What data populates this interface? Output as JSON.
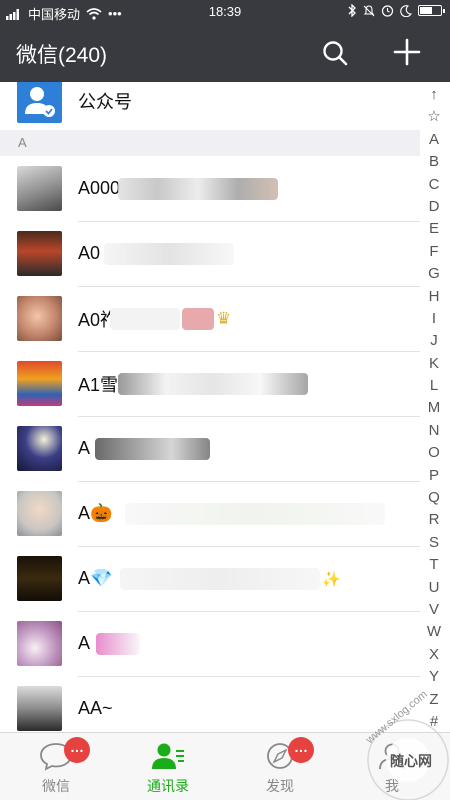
{
  "status_bar": {
    "carrier": "中国移动",
    "dots": "•••",
    "time": "18:39"
  },
  "header": {
    "title": "微信(240)"
  },
  "official_accounts": {
    "label": "公众号"
  },
  "section": {
    "letter": "A"
  },
  "contacts": [
    {
      "name": "A000"
    },
    {
      "name": "A0"
    },
    {
      "name": "A0祚"
    },
    {
      "name": "A1雪"
    },
    {
      "name": "A"
    },
    {
      "name": "A🎃"
    },
    {
      "name": "A💎"
    },
    {
      "name": "A"
    },
    {
      "name": "AA~"
    }
  ],
  "index_letters": [
    "↑",
    "☆",
    "A",
    "B",
    "C",
    "D",
    "E",
    "F",
    "G",
    "H",
    "I",
    "J",
    "K",
    "L",
    "M",
    "N",
    "O",
    "P",
    "Q",
    "R",
    "S",
    "T",
    "U",
    "V",
    "W",
    "X",
    "Y",
    "Z",
    "#"
  ],
  "tabs": [
    {
      "label": "微信",
      "badge": "…"
    },
    {
      "label": "通讯录",
      "badge": ""
    },
    {
      "label": "发现",
      "badge": "…"
    },
    {
      "label": "我",
      "badge": ""
    }
  ],
  "watermark": {
    "text": "随心网",
    "url": "www.sxlog.com"
  },
  "colors": {
    "header_bg": "#393a3f",
    "accent_green": "#1aad19",
    "badge_red": "#e64340"
  }
}
